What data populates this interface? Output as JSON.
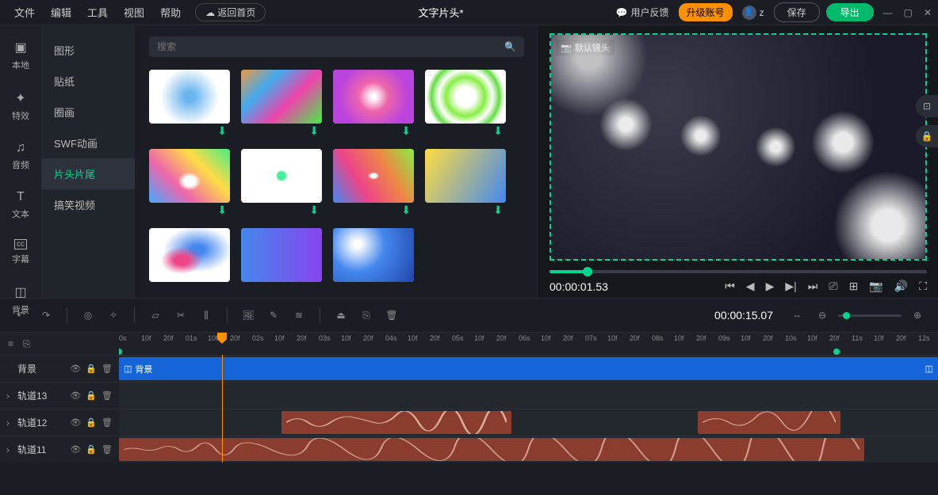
{
  "menu": {
    "file": "文件",
    "edit": "编辑",
    "tools": "工具",
    "view": "视图",
    "help": "帮助",
    "home": "返回首页"
  },
  "title": "文字片头*",
  "header": {
    "feedback": "用户反馈",
    "upgrade": "升级账号",
    "user": "z",
    "save": "保存",
    "export": "导出"
  },
  "leftTabs": [
    {
      "icon": "▣",
      "label": "本地"
    },
    {
      "icon": "✦",
      "label": "特效"
    },
    {
      "icon": "♫",
      "label": "音频"
    },
    {
      "icon": "T",
      "label": "文本"
    },
    {
      "icon": "cc",
      "label": "字幕"
    },
    {
      "icon": "◫",
      "label": "背景"
    }
  ],
  "categories": [
    {
      "label": "图形",
      "active": false
    },
    {
      "label": "贴纸",
      "active": false
    },
    {
      "label": "圈画",
      "active": false
    },
    {
      "label": "SWF动画",
      "active": false
    },
    {
      "label": "片头片尾",
      "active": true
    },
    {
      "label": "搞笑视频",
      "active": false
    }
  ],
  "search": {
    "placeholder": "搜索"
  },
  "preview": {
    "cameraLabel": "默认镜头",
    "timecode": "00:00:01.53"
  },
  "toolbar": {
    "timecode": "00:00:15.07"
  },
  "ruler": {
    "ticks": [
      "0s",
      "10f",
      "20f",
      "01s",
      "10f",
      "20f",
      "02s",
      "10f",
      "20f",
      "03s",
      "10f",
      "20f",
      "04s",
      "10f",
      "20f",
      "05s",
      "10f",
      "20f",
      "06s",
      "10f",
      "20f",
      "07s",
      "10f",
      "20f",
      "08s",
      "10f",
      "20f",
      "09s",
      "10f",
      "20f",
      "10s",
      "10f",
      "20f",
      "11s",
      "10f",
      "20f",
      "12s"
    ]
  },
  "tracks": {
    "bg": {
      "name": "背景",
      "clipLabel": "背景"
    },
    "t13": {
      "name": "轨道13"
    },
    "t12": {
      "name": "轨道12"
    },
    "t11": {
      "name": "轨道11"
    }
  }
}
